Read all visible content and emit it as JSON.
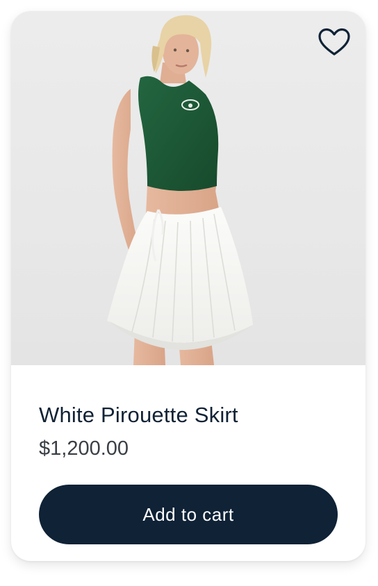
{
  "product": {
    "title": "White Pirouette Skirt",
    "price": "$1,200.00",
    "image_alt": "Model wearing green ribbed crop tank and white pleated mini skirt"
  },
  "actions": {
    "add_to_cart_label": "Add to cart",
    "wishlist_icon": "heart-outline-icon"
  },
  "colors": {
    "button_bg": "#0f2236",
    "title_text": "#102235",
    "price_text": "#3a3f45",
    "top_green": "#1f5a35",
    "skirt_white": "#f7f7f5"
  }
}
